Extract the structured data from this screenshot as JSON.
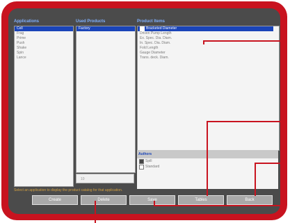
{
  "headers": {
    "applications": "Applications",
    "used_products": "Used Products",
    "product_items": "Product Items"
  },
  "applications": [
    "Cell",
    "Frag",
    "Prime",
    "Push",
    "Shake",
    "Spin",
    "Lance"
  ],
  "used_products": [
    "Factory"
  ],
  "product_items": [
    "Bracketed Diameter",
    "Driven Pump Length",
    "Ex. Spec. Dia. Diam.",
    "In. Spec. Dia. Diam.",
    "Fold Length",
    "Gauge Diameter",
    "Trans. deck. Diam."
  ],
  "authors": {
    "header": "Authors",
    "items": [
      {
        "label": "Spill",
        "checked": true
      },
      {
        "label": "Standard",
        "checked": false
      }
    ]
  },
  "small_input": {
    "value": "10"
  },
  "status_text": "Select an application to display the product catalog for that application.",
  "buttons": {
    "create": "Create",
    "delete": "Delete",
    "save": "Save",
    "tables": "Tables",
    "back": "Back"
  },
  "colors": {
    "frame": "#c8131f",
    "selection": "#1a44b8",
    "header_text": "#7fb0ff",
    "status_text": "#d4a040"
  }
}
